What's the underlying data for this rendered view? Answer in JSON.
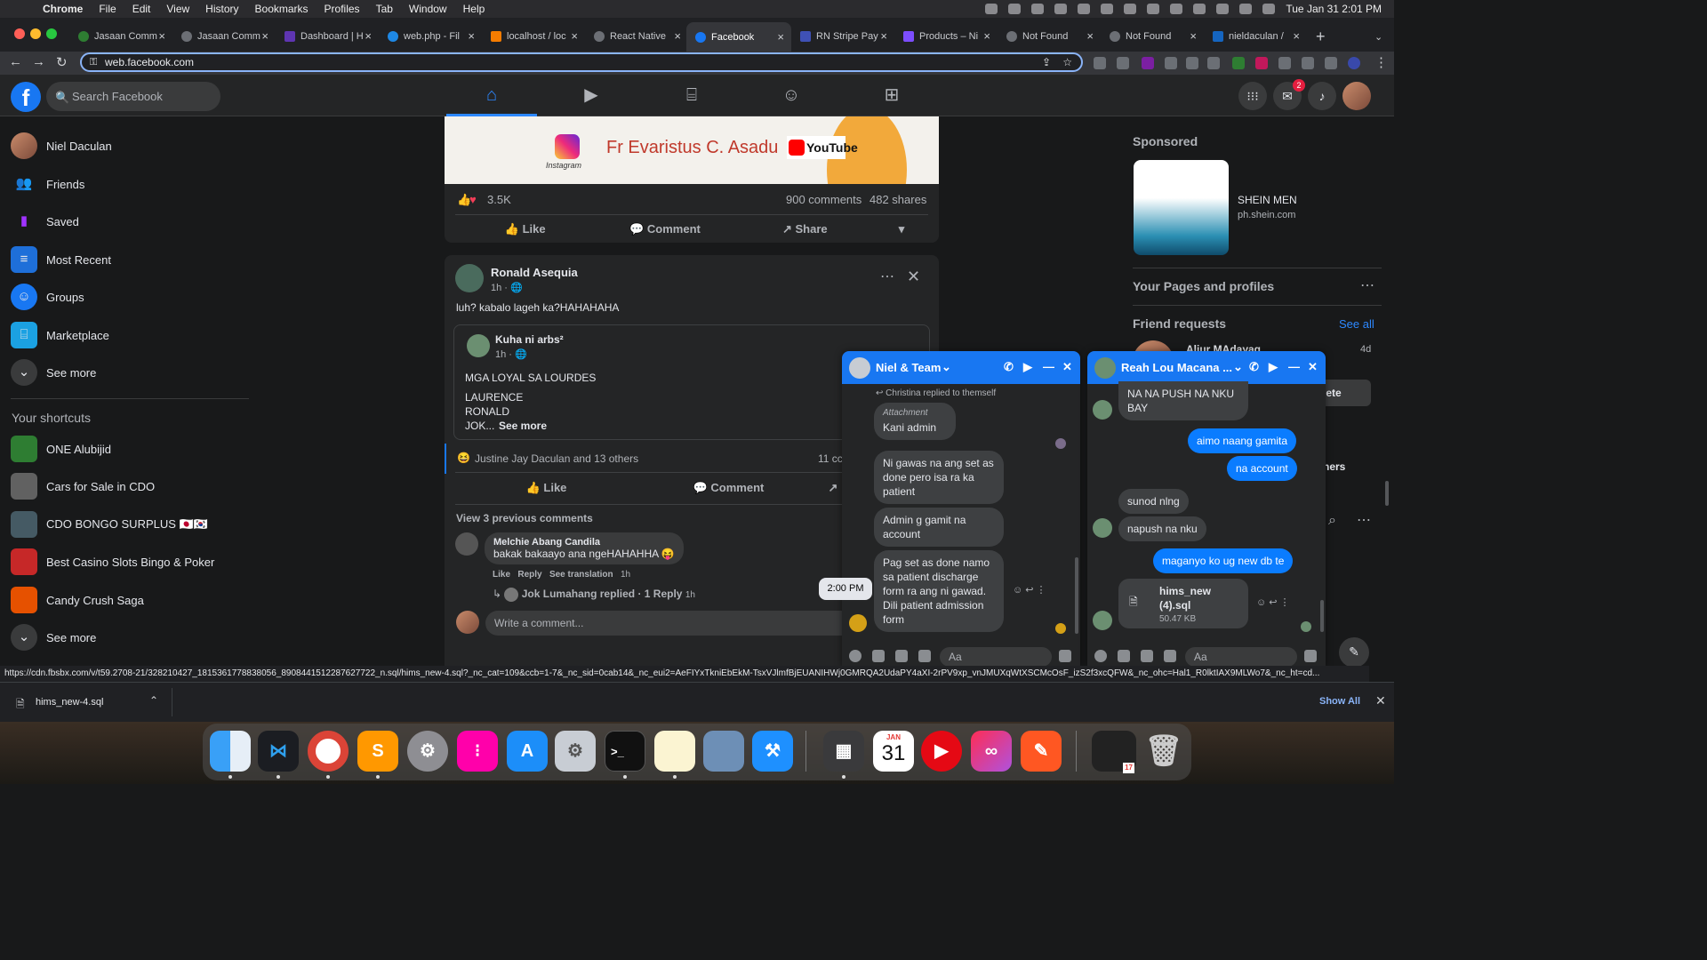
{
  "macos": {
    "app": "Chrome",
    "menus": [
      "File",
      "Edit",
      "View",
      "History",
      "Bookmarks",
      "Profiles",
      "Tab",
      "Window",
      "Help"
    ],
    "clock": "Tue Jan 31  2:01 PM"
  },
  "browser": {
    "tabs": [
      {
        "label": "Jasaan Comm",
        "active": false
      },
      {
        "label": "Jasaan Comm",
        "active": false
      },
      {
        "label": "Dashboard | H",
        "active": false
      },
      {
        "label": "web.php - Fil",
        "active": false
      },
      {
        "label": "localhost / loc",
        "active": false
      },
      {
        "label": "React Native",
        "active": false
      },
      {
        "label": "Facebook",
        "active": true
      },
      {
        "label": "RN Stripe Pay",
        "active": false
      },
      {
        "label": "Products – Ni",
        "active": false
      },
      {
        "label": "Not Found",
        "active": false
      },
      {
        "label": "Not Found",
        "active": false
      },
      {
        "label": "nieldaculan /",
        "active": false
      }
    ],
    "url": "web.facebook.com",
    "status_url": "https://cdn.fbsbx.com/v/t59.2708-21/328210427_1815361778838056_8908441512287627722_n.sql/hims_new-4.sql?_nc_cat=109&ccb=1-7&_nc_sid=0cab14&_nc_eui2=AeFIYxTkniEbEkM-TsxVJlmfBjEUANIHWj0GMRQA2UdaPY4aXI-2rPV9xp_vnJMUXqWtXSCMcOsF_izS2f3xcQFW&_nc_ohc=Hal1_R0lktIAX9MLWo7&_nc_ht=cd...",
    "download_file": "hims_new-4.sql",
    "show_all": "Show All"
  },
  "facebook": {
    "search_placeholder": "Search Facebook",
    "messenger_badge": "2",
    "sidebar": [
      {
        "label": "Niel Daculan",
        "icon": "avatar"
      },
      {
        "label": "Friends",
        "icon": "friends-icon"
      },
      {
        "label": "Saved",
        "icon": "bookmark-icon"
      },
      {
        "label": "Most Recent",
        "icon": "feed-icon"
      },
      {
        "label": "Groups",
        "icon": "groups-icon"
      },
      {
        "label": "Marketplace",
        "icon": "store-icon"
      },
      {
        "label": "See more",
        "icon": "chevron-down-icon"
      }
    ],
    "shortcuts_title": "Your shortcuts",
    "shortcuts": [
      {
        "label": "ONE Alubijid"
      },
      {
        "label": "Cars for Sale in CDO"
      },
      {
        "label": "CDO BONGO SURPLUS 🇯🇵🇰🇷"
      },
      {
        "label": "Best Casino Slots Bingo & Poker"
      },
      {
        "label": "Candy Crush Saga"
      },
      {
        "label": "See more"
      }
    ],
    "post1": {
      "banner_name": "Fr Evaristus C. Asadu",
      "instagram_label": "Instagram",
      "youtube_label": "YouTube",
      "reactions": "3.5K",
      "comments": "900 comments",
      "shares": "482 shares",
      "like": "Like",
      "comment": "Comment",
      "share": "Share"
    },
    "post2": {
      "author": "Ronald Asequia",
      "time": "1h · 🌐",
      "text": "luh? kabalo lageh ka?HAHAHAHA",
      "shared_author": "Kuha ni arbs²",
      "shared_time": "1h · 🌐",
      "shared_line1": "MGA LOYAL SA LOURDES",
      "shared_line2": "LAURENCE",
      "shared_line3": "RONALD",
      "shared_line4": "JOK...",
      "see_more": "See more",
      "reactors": "Justine Jay Daculan and 13 others",
      "comments_count": "11 cc",
      "like": "Like",
      "comment": "Comment",
      "view_previous": "View 3 previous comments",
      "c_author": "Melchie Abang Candila",
      "c_text": "bakak bakaayo ana ngeHAHAHHA 😝",
      "c_like": "Like",
      "c_reply": "Reply",
      "c_translate": "See translation",
      "c_time": "1h",
      "reply_summary": "Jok Lumahang replied · 1 Reply",
      "reply_time": "1h",
      "write_placeholder": "Write a comment..."
    },
    "right": {
      "sponsored": "Sponsored",
      "ad_title": "SHEIN MEN",
      "ad_domain": "ph.shein.com",
      "pages_title": "Your Pages and profiles",
      "friend_requests": "Friend requests",
      "see_all": "See all",
      "request_name": "Aljur MAdayag",
      "request_time": "4d",
      "delete_partial": "lete",
      "others_partial": "hers"
    },
    "chat1": {
      "name": "Niel & Team",
      "replied_note": "↩ Christina replied to themself",
      "attachment": "Attachment",
      "messages": [
        "Kani admin",
        "Ni gawas na ang set as done pero isa ra ka patient",
        "Admin g gamit na account",
        "Pag set as done namo sa patient discharge form ra ang ni gawad. Dili patient admission form"
      ],
      "timestamp": "2:00 PM",
      "input": "Aa"
    },
    "chat2": {
      "name": "Reah Lou Macana ...",
      "in1": "NA NA PUSH NA NKU BAY",
      "out1": "aimo naang gamita",
      "out2": "na account",
      "in2": "sunod nlng",
      "in3": "napush na nku",
      "out3": "maganyo ko ug new db te",
      "file_name": "hims_new (4).sql",
      "file_size": "50.47 KB",
      "input": "Aa"
    }
  },
  "dock": {
    "calendar_month": "JAN",
    "calendar_day": "31",
    "badge": "17"
  },
  "colors": {
    "fb_blue": "#1877f2",
    "bg": "#18191a",
    "card": "#242526"
  }
}
